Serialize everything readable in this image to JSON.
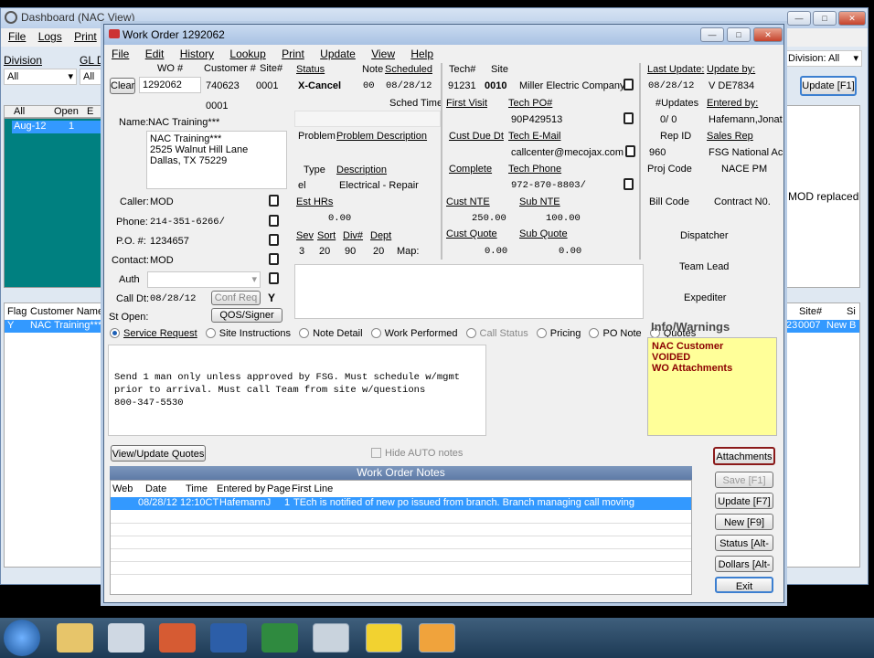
{
  "dashboard": {
    "title": "Dashboard (NAC View)",
    "menu": [
      "File",
      "Logs",
      "Print"
    ],
    "division_label": "Division",
    "gl_label": "GL De",
    "division_value": "All",
    "gl_value": "All",
    "left_table": {
      "headers": [
        "All",
        "Open",
        "E"
      ],
      "row": [
        "Aug-12",
        "1"
      ]
    },
    "bottom_headers": [
      "Flag",
      "Customer Name"
    ],
    "bottom_row": [
      "Y",
      "NAC Training***"
    ],
    "right_division": "Division: All",
    "update_btn": "Update [F1]",
    "mod_replaced": "MOD replaced",
    "right_headers": [
      "Site#",
      "Si"
    ],
    "right_row": [
      "23",
      "0007",
      "New B"
    ]
  },
  "wo": {
    "title": "Work Order 1292062",
    "menu": [
      "File",
      "Edit",
      "History",
      "Lookup",
      "Print",
      "Update",
      "View",
      "Help"
    ],
    "clear": "Clear",
    "wo_label": "WO #",
    "wo": "1292062",
    "cust_label": "Customer #",
    "cust": "740623",
    "site_label": "Site#",
    "site": "0001",
    "site2": "0001",
    "name_label": "Name:",
    "name": "NAC Training***",
    "addr": [
      "NAC Training***",
      "2525 Walnut Hill Lane",
      "Dallas, TX 75229"
    ],
    "caller_label": "Caller:",
    "caller": "MOD",
    "phone_label": "Phone:",
    "phone": "214-351-6266/",
    "po_label": "P.O. #:",
    "po": "1234657",
    "contact_label": "Contact:",
    "contact": "MOD",
    "auth_label": "Auth",
    "calldt_label": "Call Dt:",
    "calldt": "08/28/12",
    "conf_req": "Conf Req",
    "y": "Y",
    "stopen_label": "St Open:",
    "qos": "QOS/Signer",
    "status_label": "Status",
    "status": "X-Cancel",
    "note_label": "Note",
    "note": "00",
    "sched_label": "Scheduled",
    "sched": "08/28/12",
    "sched_time": "Sched Time",
    "problem_label": "Problem",
    "problem_desc_label": "Problem Description",
    "type_label": "Type",
    "type": "el",
    "desc_label": "Description",
    "desc": "Electrical - Repair",
    "esthr_label": "Est HRs",
    "esthr": "0.00",
    "sev_label": "Sev",
    "sev": "3",
    "sort_label": "Sort",
    "sort": "20",
    "div_label": "Div#",
    "div": "90",
    "dept_label": "Dept",
    "dept": "20",
    "map": "Map:",
    "tech_label": "Tech#",
    "tech": "91231",
    "site_hdr": "Site",
    "site_num": "0010",
    "site_name": "Miller Electric Company",
    "first_visit": "First Visit",
    "tech_po_label": "Tech PO#",
    "tech_po": "90P429513",
    "cust_due": "Cust Due Dt",
    "tech_email_label": "Tech E-Mail",
    "tech_email": "callcenter@mecojax.com",
    "complete": "Complete",
    "tech_phone_label": "Tech Phone",
    "tech_phone": "972-870-8803/",
    "cust_nte_label": "Cust NTE",
    "cust_nte": "250.00",
    "sub_nte_label": "Sub NTE",
    "sub_nte": "100.00",
    "cust_quote_label": "Cust Quote",
    "cust_quote": "0.00",
    "sub_quote_label": "Sub Quote",
    "sub_quote": "0.00",
    "last_update_label": "Last Update:",
    "last_update": "08/28/12",
    "update_by_label": "Update by:",
    "update_by": "V DE7834",
    "num_updates_label": "#Updates",
    "num_updates": "0/ 0",
    "entered_by_label": "Entered by:",
    "entered_by": "Hafemann,Jonat",
    "rep_id_label": "Rep ID",
    "rep_id": "960",
    "sales_rep_label": "Sales Rep",
    "sales_rep": "FSG National Ac",
    "proj_code": "Proj Code",
    "nace_pm": "NACE PM",
    "bill_code": "Bill Code",
    "contract_no": "Contract N0.",
    "dispatcher": "Dispatcher",
    "team_lead": "Team Lead",
    "expediter": "Expediter",
    "tabs": [
      "Service Request",
      "Site Instructions",
      "Note Detail",
      "Work Performed",
      "Call Status",
      "Pricing",
      "PO Note",
      "Quotes"
    ],
    "instructions": "Send 1 man only unless approved by FSG. Must schedule w/mgmt\nprior to arrival. Must call Team from site w/questions\n800-347-5530",
    "info_title": "Info/Warnings",
    "warnings": [
      "NAC Customer",
      "VOIDED",
      "WO Attachments"
    ],
    "view_quotes": "View/Update Quotes",
    "hide_auto": "Hide AUTO notes",
    "notes_title": "Work Order Notes",
    "notes_headers": [
      "Web",
      "Date",
      "Time",
      "Entered by",
      "Page",
      "First Line"
    ],
    "note_row": [
      "",
      "08/28/12",
      "12:10CT",
      "HafemannJ",
      "1",
      "TEch is notified of new po issued from branch.  Branch managing call moving"
    ],
    "buttons": [
      "Attachments",
      "Save [F1]",
      "Update [F7]",
      "New [F9]",
      "Status [Alt-S]",
      "Dollars [Alt-D]",
      "Exit"
    ]
  },
  "colors": {
    "teal": "#008080",
    "select": "#3399ff",
    "warn_bg": "#ffff99",
    "warn_fg": "#8b0000",
    "title_blue": "#4a6fa5"
  }
}
